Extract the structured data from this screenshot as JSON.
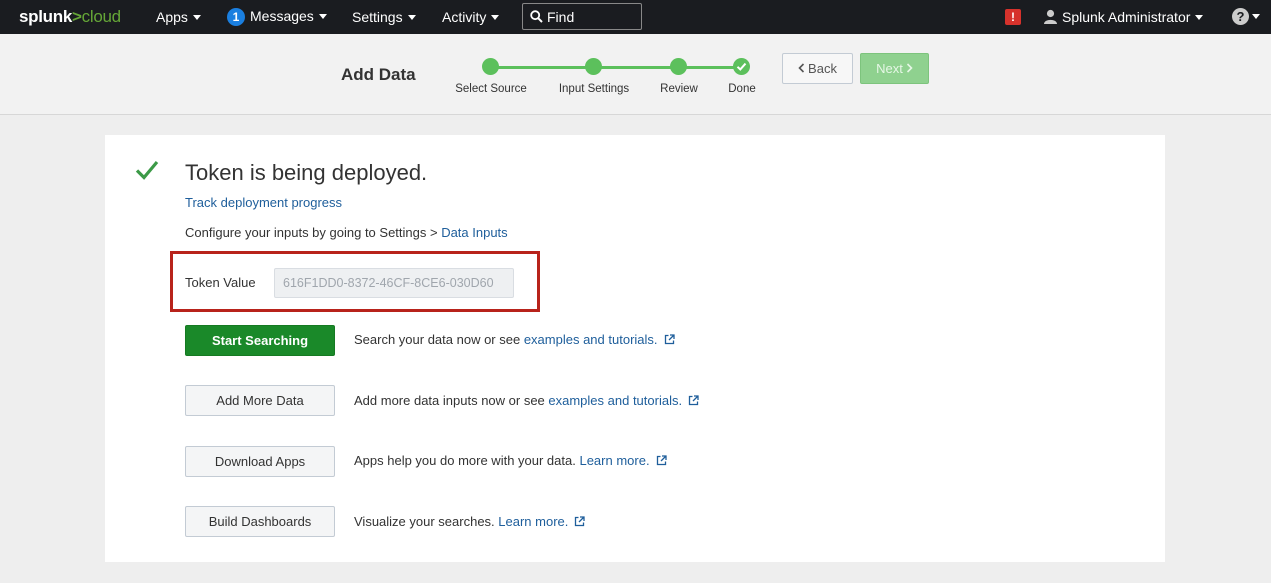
{
  "nav": {
    "logo_splunk": "splunk",
    "logo_gt": ">",
    "logo_cloud": "cloud",
    "apps": "Apps",
    "messages_count": "1",
    "messages": "Messages",
    "settings": "Settings",
    "activity": "Activity",
    "find_placeholder": "Find",
    "alert_symbol": "!",
    "user": "Splunk Administrator",
    "help_symbol": "?"
  },
  "wizard": {
    "title": "Add Data",
    "steps": [
      {
        "label": "Select Source",
        "status": "complete"
      },
      {
        "label": "Input Settings",
        "status": "complete"
      },
      {
        "label": "Review",
        "status": "complete"
      },
      {
        "label": "Done",
        "status": "current-complete"
      }
    ],
    "back_label": "Back",
    "next_label": "Next"
  },
  "content": {
    "headline": "Token is being deployed.",
    "track_link": "Track deployment progress",
    "config_prefix": "Configure your inputs by going to Settings > ",
    "config_link": "Data Inputs",
    "token_label": "Token Value",
    "token_value": "616F1DD0-8372-46CF-8CE6-030D60",
    "actions": [
      {
        "button": "Start Searching",
        "text": "Search your data now or see ",
        "link": "examples and tutorials."
      },
      {
        "button": "Add More Data",
        "text": "Add more data inputs now or see ",
        "link": "examples and tutorials."
      },
      {
        "button": "Download Apps",
        "text": "Apps help you do more with your data. ",
        "link": "Learn more."
      },
      {
        "button": "Build Dashboards",
        "text": "Visualize your searches. ",
        "link": "Learn more."
      }
    ]
  },
  "colors": {
    "nav_bg": "#1a1c20",
    "accent_green": "#5cc05c",
    "primary_button": "#1a8929",
    "link": "#1e5e9b",
    "highlight_border": "#b8231b",
    "alert": "#d6322c"
  }
}
